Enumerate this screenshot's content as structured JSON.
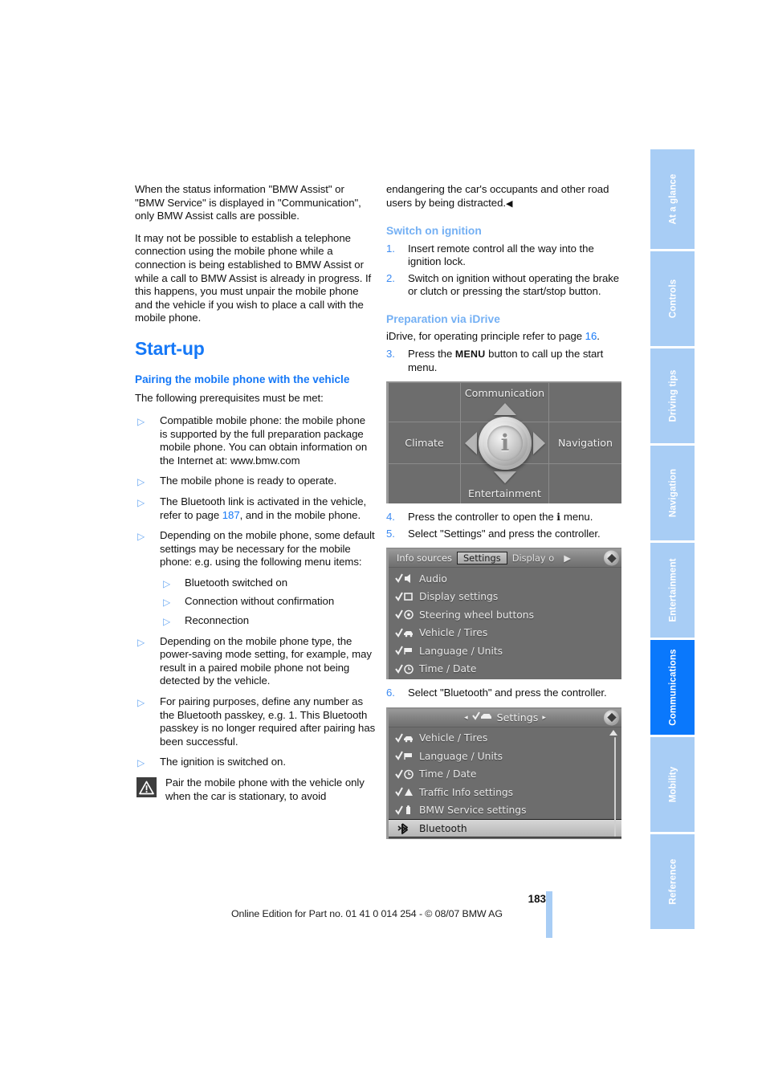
{
  "document": {
    "page_number": "183",
    "footer": "Online Edition for Part no. 01 41 0 014 254 - © 08/07 BMW AG"
  },
  "sidebar": {
    "tabs": [
      {
        "label": "At a glance",
        "active": false
      },
      {
        "label": "Controls",
        "active": false
      },
      {
        "label": "Driving tips",
        "active": false
      },
      {
        "label": "Navigation",
        "active": false
      },
      {
        "label": "Entertainment",
        "active": false
      },
      {
        "label": "Communications",
        "active": true
      },
      {
        "label": "Mobility",
        "active": false
      },
      {
        "label": "Reference",
        "active": false
      }
    ],
    "colors": {
      "inactive": "#a8cdf5",
      "active": "#0a78fc"
    }
  },
  "left_column": {
    "intro_paragraph_1": "When the status information \"BMW Assist\" or \"BMW Service\" is displayed in \"Communication\", only BMW Assist calls are possible.",
    "intro_paragraph_2": "It may not be possible to establish a telephone connection using the mobile phone while a connection is being established to BMW Assist or while a call to BMW Assist is already in progress. If this happens, you must unpair the mobile phone and the vehicle if you wish to place a call with the mobile phone.",
    "title": "Start-up",
    "subheading": "Pairing the mobile phone with the vehicle",
    "prereq_intro": "The following prerequisites must be met:",
    "bullets": [
      "Compatible mobile phone: the mobile phone is supported by the full preparation package mobile phone. You can obtain information on the Internet at: www.bmw.com",
      "The mobile phone is ready to operate.",
      "Depending on the mobile phone, some default settings may be necessary for the mobile phone: e.g. using the following menu items:",
      "Depending on the mobile phone type, the power-saving mode setting, for example, may result in a paired mobile phone not being detected by the vehicle.",
      "For pairing purposes, define any number as the Bluetooth passkey, e.g. 1. This Bluetooth passkey is no longer required after pairing has been successful.",
      "The ignition is switched on."
    ],
    "bullet_bluetooth_prefix": "The Bluetooth link is activated in the vehicle, refer to page ",
    "bullet_bluetooth_page_ref": "187",
    "bullet_bluetooth_suffix": ", and in the mobile phone.",
    "sub_bullets": [
      "Bluetooth switched on",
      "Connection without confirmation",
      "Reconnection"
    ],
    "warning_text": "Pair the mobile phone with the vehicle only when the car is stationary, to avoid"
  },
  "right_column": {
    "warning_continuation": "endangering the car's occupants and other road users by being distracted.",
    "end_mark": "◀",
    "heading_ignition": "Switch on ignition",
    "steps_ignition": [
      {
        "num": "1.",
        "text": "Insert remote control all the way into the ignition lock."
      },
      {
        "num": "2.",
        "text": "Switch on ignition without operating the brake or clutch or pressing the start/stop button."
      }
    ],
    "heading_idrive": "Preparation via iDrive",
    "idrive_intro_prefix": "iDrive, for operating principle refer to page ",
    "idrive_intro_page_ref": "16",
    "idrive_intro_suffix": ".",
    "step3": {
      "num": "3.",
      "prefix": "Press the ",
      "keyword": "MENU",
      "suffix": " button to call up the start menu."
    },
    "step4": {
      "num": "4.",
      "prefix": "Press the controller to open the ",
      "icon": "i",
      "suffix": " menu."
    },
    "step5": {
      "num": "5.",
      "text": "Select \"Settings\" and press the controller."
    },
    "step6": {
      "num": "6.",
      "text": "Select \"Bluetooth\" and press the controller."
    }
  },
  "screenshots": {
    "start_menu": {
      "name": "idrive-start-menu",
      "center_icon": "i",
      "cells": [
        {
          "label": "",
          "pos": "tl"
        },
        {
          "label": "Communication",
          "pos": "top"
        },
        {
          "label": "",
          "pos": "tr"
        },
        {
          "label": "Climate",
          "pos": "left"
        },
        {
          "label": "",
          "pos": "center"
        },
        {
          "label": "Navigation",
          "pos": "right"
        },
        {
          "label": "",
          "pos": "bl"
        },
        {
          "label": "Entertainment",
          "pos": "bottom"
        },
        {
          "label": "",
          "pos": "br"
        }
      ]
    },
    "settings_menu": {
      "name": "idrive-settings-menu",
      "tabs": [
        {
          "label": "Info sources",
          "selected": false
        },
        {
          "label": "Settings",
          "selected": true
        },
        {
          "label": "Display o",
          "selected": false
        }
      ],
      "tab_overflow_arrow": "▶",
      "rows": [
        {
          "label": "Audio",
          "icon": "check-audio-icon",
          "highlight": false
        },
        {
          "label": "Display settings",
          "icon": "check-display-icon",
          "highlight": false
        },
        {
          "label": "Steering wheel buttons",
          "icon": "check-steering-wheel-icon",
          "highlight": false
        },
        {
          "label": "Vehicle / Tires",
          "icon": "check-vehicle-icon",
          "highlight": false
        },
        {
          "label": "Language / Units",
          "icon": "check-language-icon",
          "highlight": false
        },
        {
          "label": "Time / Date",
          "icon": "check-clock-icon",
          "highlight": false
        }
      ]
    },
    "bluetooth_menu": {
      "name": "idrive-settings-bluetooth",
      "title": "Settings",
      "title_left_arrow": "◂",
      "title_right_arrow": "▸",
      "rows": [
        {
          "label": "Vehicle / Tires",
          "icon": "check-vehicle-icon",
          "highlight": false
        },
        {
          "label": "Language / Units",
          "icon": "check-language-icon",
          "highlight": false
        },
        {
          "label": "Time / Date",
          "icon": "check-clock-icon",
          "highlight": false
        },
        {
          "label": "Traffic Info settings",
          "icon": "check-warning-icon",
          "highlight": false
        },
        {
          "label": "BMW Service settings",
          "icon": "check-service-icon",
          "highlight": false
        },
        {
          "label": "Bluetooth",
          "icon": "bluetooth-icon",
          "highlight": true
        }
      ]
    }
  }
}
